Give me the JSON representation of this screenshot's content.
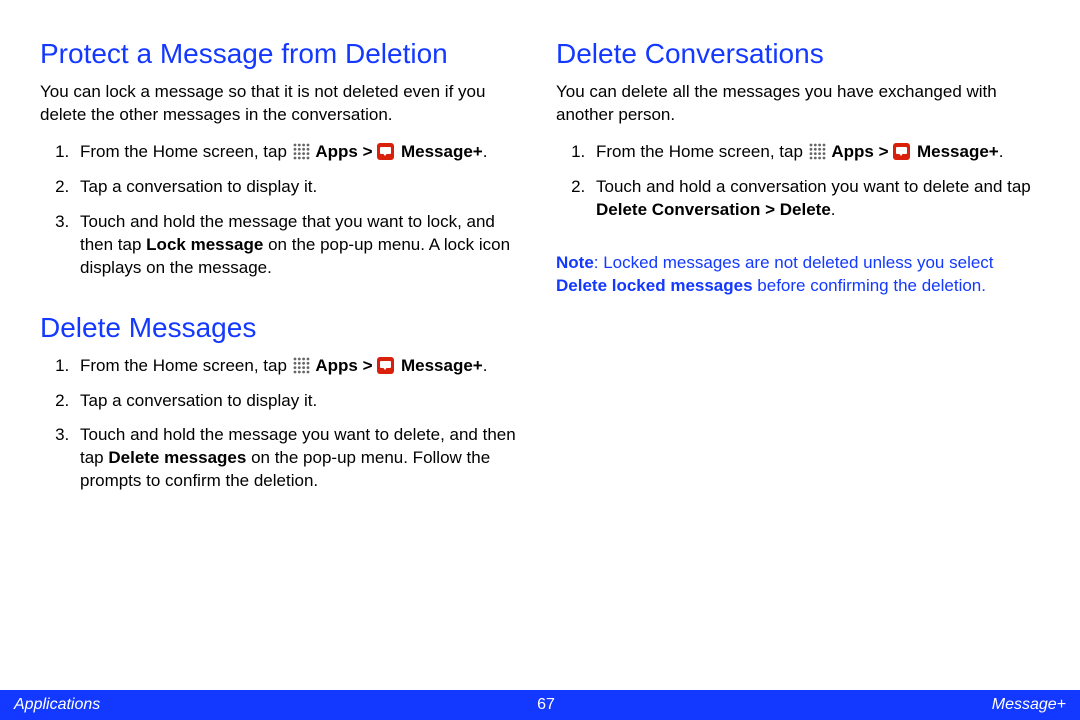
{
  "left": {
    "section1": {
      "heading": "Protect a Message from Deletion",
      "intro": "You can lock a message so that it is not deleted even if you delete the other messages in the conversation.",
      "step1_a": "From the Home screen, tap ",
      "apps_label": "Apps",
      "gt": " > ",
      "msgplus_label": "Message+",
      "period": ".",
      "step2": "Tap a conversation to display it.",
      "step3_a": "Touch and hold the message that you want to lock, and then tap ",
      "step3_bold": "Lock message",
      "step3_b": " on the pop-up menu. A lock icon displays on the message."
    },
    "section2": {
      "heading": "Delete Messages",
      "step1_a": "From the Home screen, tap ",
      "apps_label": "Apps",
      "gt": " > ",
      "msgplus_label": "Message+",
      "period": ".",
      "step2": "Tap a conversation to display it.",
      "step3_a": "Touch and hold the message you want to delete, and then tap ",
      "step3_bold": "Delete messages",
      "step3_b": " on the pop-up menu. Follow the prompts to confirm the deletion."
    }
  },
  "right": {
    "section1": {
      "heading": "Delete Conversations",
      "intro": "You can delete all the messages you have exchanged with another person.",
      "step1_a": "From the Home screen, tap ",
      "apps_label": "Apps",
      "gt": " > ",
      "msgplus_label": "Message+",
      "period": ".",
      "step2_a": "Touch and hold a conversation you want to delete and tap ",
      "step2_bold": "Delete Conversation > Delete",
      "step2_b": ".",
      "note_label": "Note",
      "note_a": ": Locked messages are not deleted unless you select ",
      "note_bold": "Delete locked messages",
      "note_b": " before confirming the deletion."
    }
  },
  "footer": {
    "left": "Applications",
    "center": "67",
    "right": "Message+"
  }
}
